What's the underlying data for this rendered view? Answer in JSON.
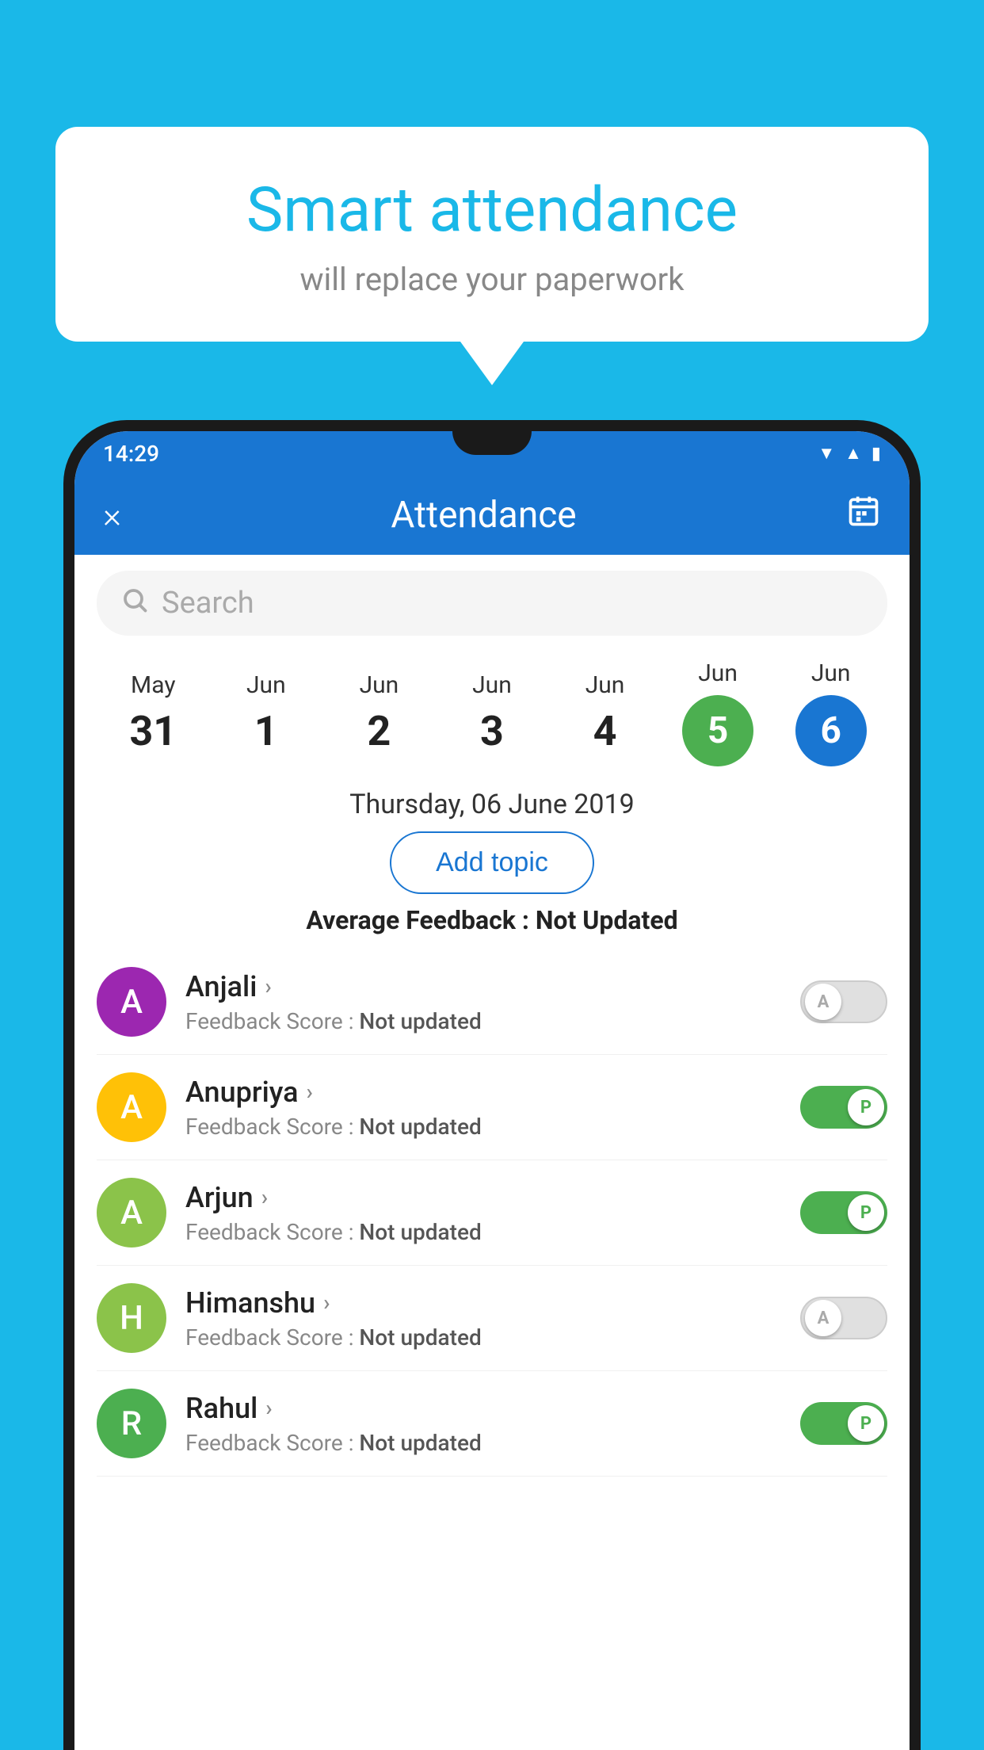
{
  "background_color": "#1ab8e8",
  "speech_bubble": {
    "title": "Smart attendance",
    "subtitle": "will replace your paperwork"
  },
  "status_bar": {
    "time": "14:29",
    "icons": [
      "wifi",
      "signal",
      "battery"
    ]
  },
  "app_header": {
    "title": "Attendance",
    "close_label": "×",
    "calendar_label": "📅"
  },
  "search": {
    "placeholder": "Search"
  },
  "calendar": {
    "days": [
      {
        "month": "May",
        "date": "31",
        "state": "normal"
      },
      {
        "month": "Jun",
        "date": "1",
        "state": "normal"
      },
      {
        "month": "Jun",
        "date": "2",
        "state": "normal"
      },
      {
        "month": "Jun",
        "date": "3",
        "state": "normal"
      },
      {
        "month": "Jun",
        "date": "4",
        "state": "normal"
      },
      {
        "month": "Jun",
        "date": "5",
        "state": "today"
      },
      {
        "month": "Jun",
        "date": "6",
        "state": "selected"
      }
    ]
  },
  "selected_date_label": "Thursday, 06 June 2019",
  "add_topic_button": "Add topic",
  "average_feedback": {
    "label": "Average Feedback : ",
    "value": "Not Updated"
  },
  "students": [
    {
      "name": "Anjali",
      "avatar_letter": "A",
      "avatar_color": "#9c27b0",
      "feedback_label": "Feedback Score : ",
      "feedback_value": "Not updated",
      "toggle_state": "off",
      "toggle_label": "A"
    },
    {
      "name": "Anupriya",
      "avatar_letter": "A",
      "avatar_color": "#ffc107",
      "feedback_label": "Feedback Score : ",
      "feedback_value": "Not updated",
      "toggle_state": "on",
      "toggle_label": "P"
    },
    {
      "name": "Arjun",
      "avatar_letter": "A",
      "avatar_color": "#8bc34a",
      "feedback_label": "Feedback Score : ",
      "feedback_value": "Not updated",
      "toggle_state": "on",
      "toggle_label": "P"
    },
    {
      "name": "Himanshu",
      "avatar_letter": "H",
      "avatar_color": "#8bc34a",
      "feedback_label": "Feedback Score : ",
      "feedback_value": "Not updated",
      "toggle_state": "off",
      "toggle_label": "A"
    },
    {
      "name": "Rahul",
      "avatar_letter": "R",
      "avatar_color": "#4caf50",
      "feedback_label": "Feedback Score : ",
      "feedback_value": "Not updated",
      "toggle_state": "on",
      "toggle_label": "P"
    }
  ]
}
